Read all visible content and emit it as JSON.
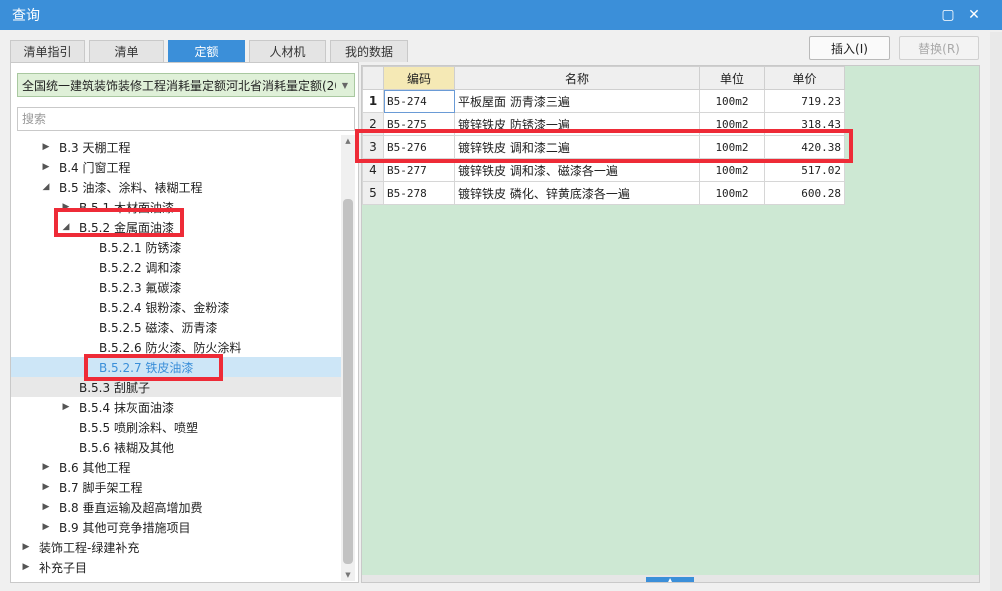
{
  "window": {
    "title": "查询",
    "restore_glyph": "▢",
    "close_glyph": "✕"
  },
  "tabs": [
    "清单指引",
    "清单",
    "定额",
    "人材机",
    "我的数据"
  ],
  "active_tab": 2,
  "buttons": {
    "insert": "插入(I)",
    "replace": "替换(R)"
  },
  "left": {
    "library_value": "全国统一建筑装饰装修工程消耗量定额河北省消耗量定额(20",
    "search_placeholder": "搜索",
    "tree": [
      {
        "label": "B.3 天棚工程",
        "level": 2,
        "toggle": "collapsed"
      },
      {
        "label": "B.4 门窗工程",
        "level": 2,
        "toggle": "collapsed"
      },
      {
        "label": "B.5 油漆、涂料、裱糊工程",
        "level": 2,
        "toggle": "expanded"
      },
      {
        "label": "B.5.1 木材面油漆",
        "level": 3,
        "toggle": "collapsed"
      },
      {
        "label": "B.5.2 金属面油漆",
        "level": 3,
        "toggle": "expanded"
      },
      {
        "label": "B.5.2.1 防锈漆",
        "level": 4,
        "toggle": "none"
      },
      {
        "label": "B.5.2.2 调和漆",
        "level": 4,
        "toggle": "none"
      },
      {
        "label": "B.5.2.3 氟碳漆",
        "level": 4,
        "toggle": "none"
      },
      {
        "label": "B.5.2.4 银粉漆、金粉漆",
        "level": 4,
        "toggle": "none"
      },
      {
        "label": "B.5.2.5 磁漆、沥青漆",
        "level": 4,
        "toggle": "none"
      },
      {
        "label": "B.5.2.6 防火漆、防火涂料",
        "level": 4,
        "toggle": "none"
      },
      {
        "label": "B.5.2.7 铁皮油漆",
        "level": 4,
        "toggle": "none",
        "state": "selected"
      },
      {
        "label": "B.5.3 刮腻子",
        "level": 3,
        "toggle": "none",
        "state": "hover"
      },
      {
        "label": "B.5.4 抹灰面油漆",
        "level": 3,
        "toggle": "collapsed"
      },
      {
        "label": "B.5.5 喷刷涂料、喷塑",
        "level": 3,
        "toggle": "none"
      },
      {
        "label": "B.5.6 裱糊及其他",
        "level": 3,
        "toggle": "none"
      },
      {
        "label": "B.6 其他工程",
        "level": 2,
        "toggle": "collapsed"
      },
      {
        "label": "B.7 脚手架工程",
        "level": 2,
        "toggle": "collapsed"
      },
      {
        "label": "B.8 垂直运输及超高增加费",
        "level": 2,
        "toggle": "collapsed"
      },
      {
        "label": "B.9 其他可竞争措施项目",
        "level": 2,
        "toggle": "collapsed"
      },
      {
        "label": "装饰工程-绿建补充",
        "level": 1,
        "toggle": "collapsed"
      },
      {
        "label": "补充子目",
        "level": 1,
        "toggle": "collapsed"
      }
    ]
  },
  "grid": {
    "columns": [
      "编码",
      "名称",
      "单位",
      "单价"
    ],
    "current_row": 0,
    "rows": [
      {
        "num": "1",
        "code": "B5-274",
        "name": "平板屋面 沥青漆三遍",
        "unit": "100m2",
        "price": "719.23"
      },
      {
        "num": "2",
        "code": "B5-275",
        "name": "镀锌铁皮 防锈漆一遍",
        "unit": "100m2",
        "price": "318.43"
      },
      {
        "num": "3",
        "code": "B5-276",
        "name": "镀锌铁皮 调和漆二遍",
        "unit": "100m2",
        "price": "420.38"
      },
      {
        "num": "4",
        "code": "B5-277",
        "name": "镀锌铁皮 调和漆、磁漆各一遍",
        "unit": "100m2",
        "price": "517.02"
      },
      {
        "num": "5",
        "code": "B5-278",
        "name": "镀锌铁皮 磷化、锌黄底漆各一遍",
        "unit": "100m2",
        "price": "600.28"
      }
    ]
  },
  "colors": {
    "accent": "#3b8fd9",
    "highlight_box": "#ee2b37",
    "grid_empty": "#cde8d3"
  }
}
